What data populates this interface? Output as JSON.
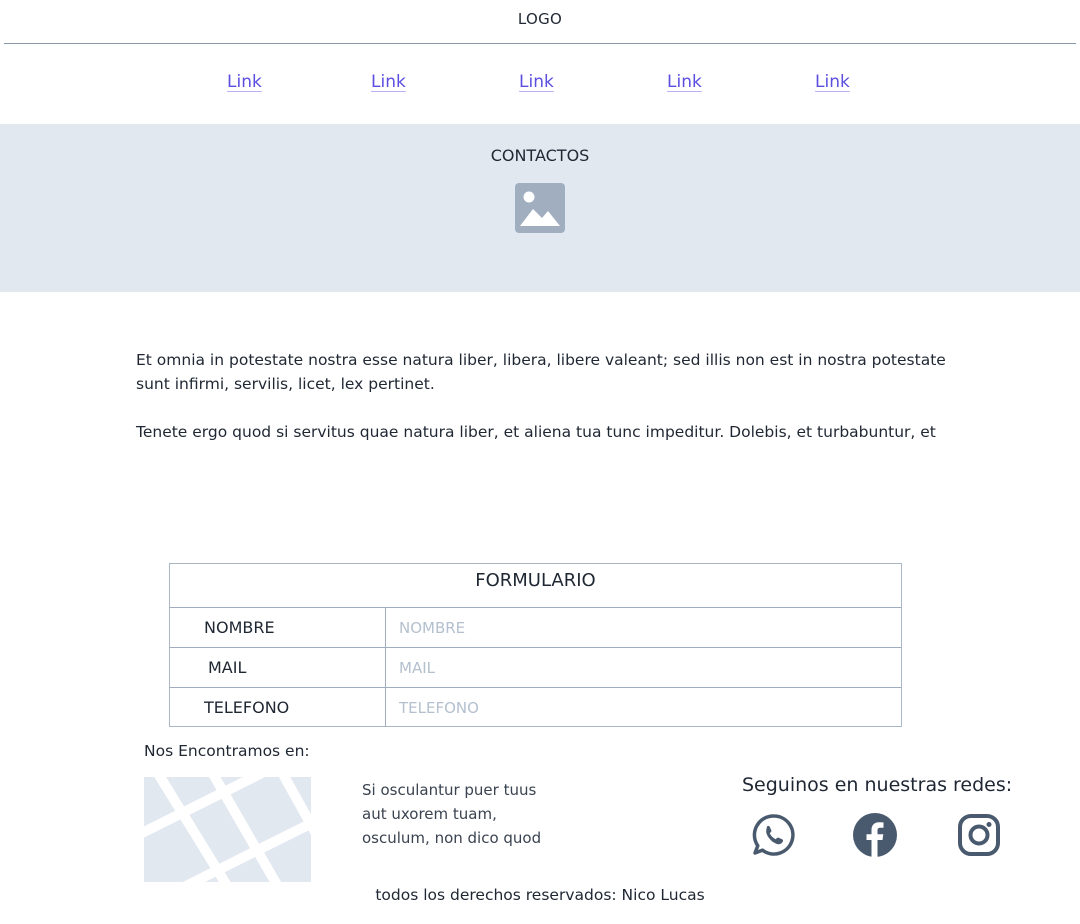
{
  "header": {
    "logo": "LOGO"
  },
  "nav": {
    "links": [
      "Link",
      "Link",
      "Link",
      "Link",
      "Link"
    ]
  },
  "hero": {
    "title": "CONTACTOS",
    "icon": "image-placeholder-icon"
  },
  "content": {
    "paragraph1": "Et omnia in potestate nostra esse natura liber, libera, libere valeant; sed illis non est in nostra potestate sunt infirmi, servilis, licet, lex pertinet.",
    "paragraph2": "Tenete ergo quod si servitus quae natura liber, et aliena tua tunc impeditur. Dolebis, et turbabuntur, et"
  },
  "form": {
    "title": "FORMULARIO",
    "fields": [
      {
        "label": "NOMBRE",
        "placeholder": "NOMBRE",
        "value": ""
      },
      {
        "label": "MAIL",
        "placeholder": "MAIL",
        "value": ""
      },
      {
        "label": "TELEFONO",
        "placeholder": "TELEFONO",
        "value": ""
      }
    ]
  },
  "footer": {
    "find_us": "Nos Encontramos en:",
    "address_lines": [
      "Si osculantur puer tuus",
      "aut uxorem tuam,",
      "osculum, non dico quod"
    ],
    "social_title": "Seguinos en nuestras redes:",
    "social_icons": [
      "whatsapp-icon",
      "facebook-icon",
      "instagram-icon"
    ],
    "copyright": "todos los derechos reservados: Nico Lucas"
  },
  "colors": {
    "link": "#5b4fe0",
    "hero_bg": "#e2e8f0",
    "icon": "#4a5a6e",
    "placeholder_icon": "#a0aec0",
    "border": "#9fadbf"
  }
}
